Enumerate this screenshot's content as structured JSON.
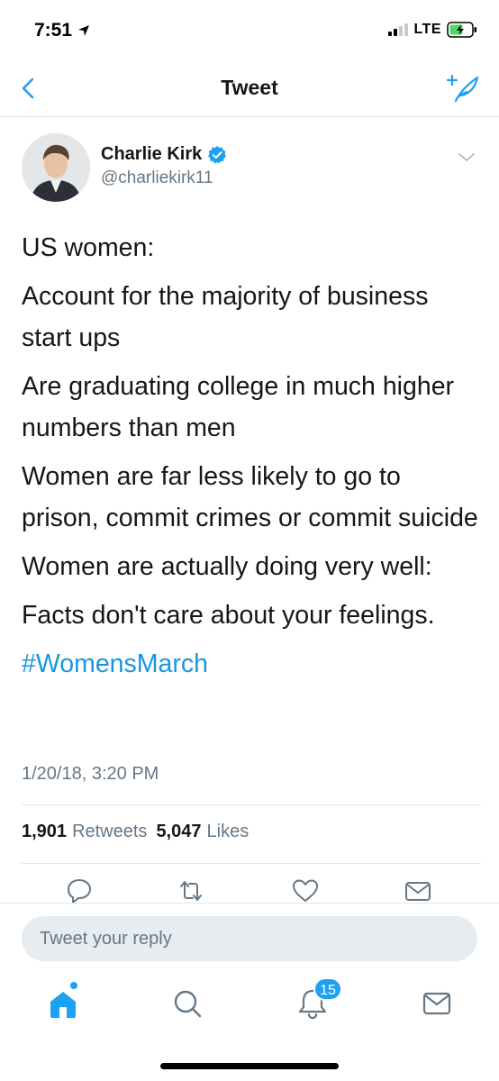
{
  "status": {
    "time": "7:51",
    "network": "LTE"
  },
  "nav": {
    "title": "Tweet"
  },
  "tweet": {
    "author_name": "Charlie Kirk",
    "author_handle": "@charliekirk11",
    "verified": true,
    "paragraphs": [
      "US women:",
      "Account for the majority of business start ups",
      "Are graduating college in much higher numbers than men",
      "Women are far less likely to go to prison, commit crimes or commit suicide",
      "Women are actually doing very well:",
      "Facts don't care about your feelings."
    ],
    "hashtag": "#WomensMarch",
    "timestamp": "1/20/18, 3:20 PM",
    "retweets_count": "1,901",
    "retweets_label": "Retweets",
    "likes_count": "5,047",
    "likes_label": "Likes"
  },
  "reply": {
    "placeholder": "Tweet your reply"
  },
  "tabbar": {
    "notifications_badge": "15"
  },
  "colors": {
    "accent": "#1da1f2",
    "link": "#1b95e0",
    "secondary_text": "#657786"
  },
  "icons": [
    "back-icon",
    "compose-icon",
    "verified-icon",
    "chevron-down-icon",
    "reply-icon",
    "retweet-icon",
    "like-icon",
    "dm-icon",
    "home-icon",
    "search-icon",
    "notifications-icon",
    "messages-icon"
  ]
}
